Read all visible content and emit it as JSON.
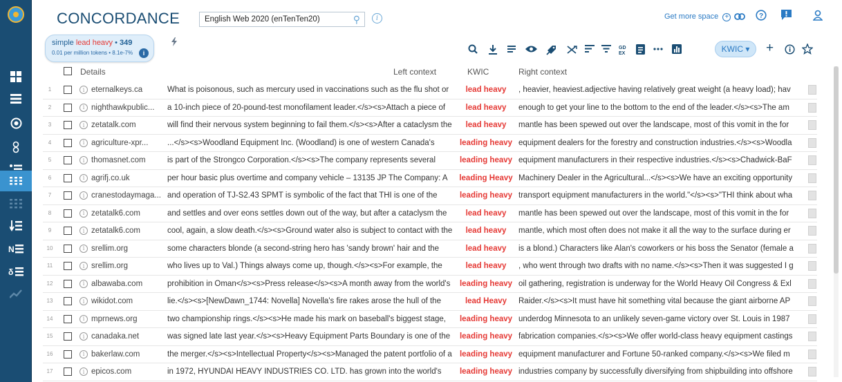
{
  "app": {
    "title": "CONCORDANCE",
    "corpus": "English Web 2020 (enTenTen20)",
    "get_more_space": "Get more space"
  },
  "query": {
    "prefix": "simple ",
    "keyword": "lead heavy",
    "separator": " • ",
    "count": "349",
    "stats": "0.01 per million tokens • 8.1e-7%"
  },
  "toolbar": {
    "view_mode": "KWIC ▾"
  },
  "table": {
    "headers": {
      "details": "Details",
      "left": "Left context",
      "kwic": "KWIC",
      "right": "Right context"
    },
    "rows": [
      {
        "n": "1",
        "src": "eternalkeys.ca",
        "left": "What is poisonous, such as mercury used in vaccinations such as the flu shot or",
        "kwic": "lead heavy",
        "right": ", heavier, heaviest.adjective having relatively great weight (a heavy load); hav"
      },
      {
        "n": "2",
        "src": "nighthawkpublic...",
        "left": "a 10-inch piece of 20-pound-test monofilament leader.</s><s>Attach a piece of",
        "kwic": "lead heavy",
        "right": "enough to get your line to the bottom to the end of the leader.</s><s>The am"
      },
      {
        "n": "3",
        "src": "zetatalk.com",
        "left": "will find their nervous system beginning to fail them.</s><s>After a cataclysm the",
        "kwic": "lead heavy",
        "right": "mantle has been spewed out over the landscape, most of this vomit in the for"
      },
      {
        "n": "4",
        "src": "agriculture-xpr...",
        "left": "...</s><s>Woodland Equipment Inc. (Woodland) is one of western Canada's",
        "kwic": "leading heavy",
        "right": "equipment dealers for the forestry and construction industries.</s><s>Woodla"
      },
      {
        "n": "5",
        "src": "thomasnet.com",
        "left": "is part of the Strongco Corporation.</s><s>The company represents several",
        "kwic": "leading heavy",
        "right": "equipment manufacturers in their respective industries.</s><s>Chadwick-BaF"
      },
      {
        "n": "6",
        "src": "agrifj.co.uk",
        "left": "per hour basic plus overtime and company vehicle – 13135 JP The Company: A",
        "kwic": "leading Heavy",
        "right": "Machinery Dealer in the Agricultural...</s><s>We have an exciting opportunity"
      },
      {
        "n": "7",
        "src": "cranestodaymaga...",
        "left": "and operation of TJ-S2.43 SPMT is symbolic of the fact that THI is one of the",
        "kwic": "leading heavy",
        "right": "transport equipment manufacturers in the world.\"</s><s>\"THI think about wha"
      },
      {
        "n": "8",
        "src": "zetatalk6.com",
        "left": "and settles and over eons settles down out of the way, but after a cataclysm the",
        "kwic": "lead heavy",
        "right": "mantle has been spewed out over the landscape, most of this vomit in the for"
      },
      {
        "n": "9",
        "src": "zetatalk6.com",
        "left": "cool, again, a slow death.</s><s>Ground water also is subject to contact with the",
        "kwic": "lead heavy",
        "right": "mantle, which most often does not make it all the way to the surface during er"
      },
      {
        "n": "10",
        "src": "srellim.org",
        "left": "some characters blonde (a second-string hero has 'sandy brown' hair and the",
        "kwic": "lead heavy",
        "right": "is a blond.) Characters like Alan's coworkers or his boss the Senator (female a"
      },
      {
        "n": "11",
        "src": "srellim.org",
        "left": "who lives up to Val.) Things always come up, though.</s><s>For example, the",
        "kwic": "lead heavy",
        "right": ", who went through two drafts with no name.</s><s>Then it was suggested I g"
      },
      {
        "n": "12",
        "src": "albawaba.com",
        "left": "prohibition in Oman</s><s>Press release</s><s>A month away from the world's",
        "kwic": "leading heavy",
        "right": "oil gathering, registration is underway for the World Heavy Oil Congress & Exl"
      },
      {
        "n": "13",
        "src": "wikidot.com",
        "left": "lie.</s><s>[NewDawn_1744: Novella] Novella's fire rakes arose the hull of the",
        "kwic": "lead Heavy",
        "right": "Raider.</s><s>It must have hit something vital because the giant airborne AP"
      },
      {
        "n": "14",
        "src": "mprnews.org",
        "left": "two championship rings.</s><s>He made his mark on baseball's biggest stage,",
        "kwic": "leading heavy",
        "right": "underdog Minnesota to an unlikely seven-game victory over St. Louis in 1987"
      },
      {
        "n": "15",
        "src": "canadaka.net",
        "left": "was signed late last year.</s><s>Heavy Equipment Parts Boundary is one of the",
        "kwic": "leading heavy",
        "right": "fabrication companies.</s><s>We offer world-class heavy equipment castings"
      },
      {
        "n": "16",
        "src": "bakerlaw.com",
        "left": "the merger.</s><s>Intellectual Property</s><s>Managed the patent portfolio of a",
        "kwic": "leading heavy",
        "right": "equipment manufacturer and Fortune 50-ranked company.</s><s>We filed m"
      },
      {
        "n": "17",
        "src": "epicos.com",
        "left": "in 1972, HYUNDAI HEAVY INDUSTRIES CO. LTD. has grown into the world's",
        "kwic": "leading heavy",
        "right": "industries company by successfully diversifying from shipbuilding into offshore"
      }
    ]
  },
  "colors": {
    "nav_bg": "#1a4d73",
    "accent": "#2a7ac4",
    "keyword": "#e53935"
  }
}
